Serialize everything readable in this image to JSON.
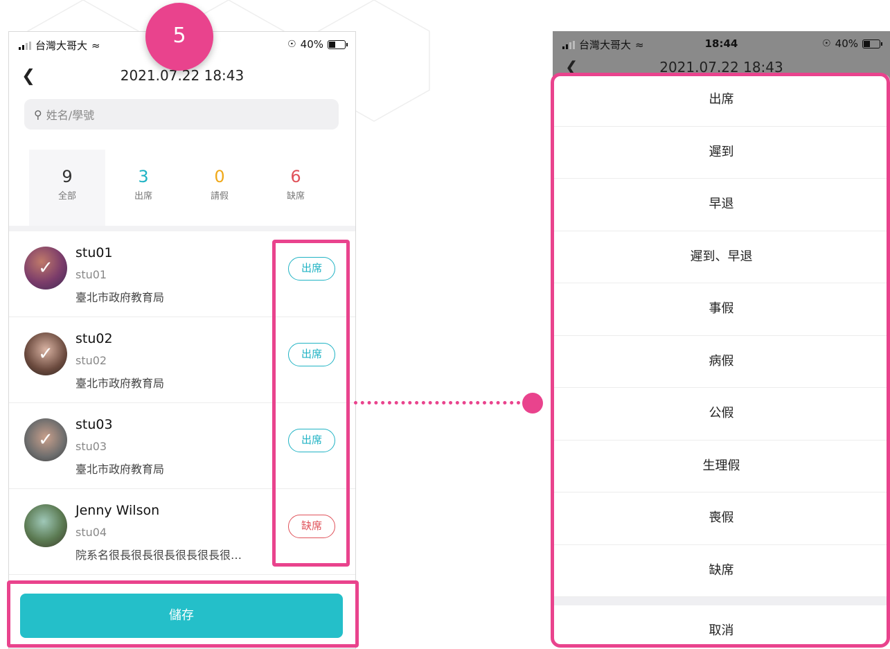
{
  "step_number": "5",
  "left_screen": {
    "status": {
      "carrier": "台灣大哥大",
      "battery": "40%"
    },
    "title": "2021.07.22 18:43",
    "search_placeholder": "姓名/學號",
    "stats": [
      {
        "count": "9",
        "label": "全部",
        "color": "#333333"
      },
      {
        "count": "3",
        "label": "出席",
        "color": "#20b3c4"
      },
      {
        "count": "0",
        "label": "請假",
        "color": "#f0a91a"
      },
      {
        "count": "6",
        "label": "缺席",
        "color": "#e0525a"
      }
    ],
    "students": [
      {
        "name": "stu01",
        "id": "stu01",
        "org": "臺北市政府教育局",
        "status": "出席",
        "checked": true
      },
      {
        "name": "stu02",
        "id": "stu02",
        "org": "臺北市政府教育局",
        "status": "出席",
        "checked": true
      },
      {
        "name": "stu03",
        "id": "stu03",
        "org": "臺北市政府教育局",
        "status": "出席",
        "checked": true
      },
      {
        "name": "Jenny Wilson",
        "id": "stu04",
        "org": "院系名很長很長很長很長很長很…",
        "status": "缺席",
        "checked": false
      }
    ],
    "save_label": "儲存"
  },
  "right_screen": {
    "status": {
      "carrier": "台灣大哥大",
      "time": "18:44",
      "battery": "40%"
    },
    "title": "2021.07.22 18:43",
    "options": [
      "出席",
      "遲到",
      "早退",
      "遲到、早退",
      "事假",
      "病假",
      "公假",
      "生理假",
      "喪假",
      "缺席"
    ],
    "cancel_label": "取消"
  },
  "colors": {
    "accent": "#24bfc9",
    "highlight": "#e9438d",
    "absent": "#e0525a",
    "leave": "#f0a91a"
  }
}
